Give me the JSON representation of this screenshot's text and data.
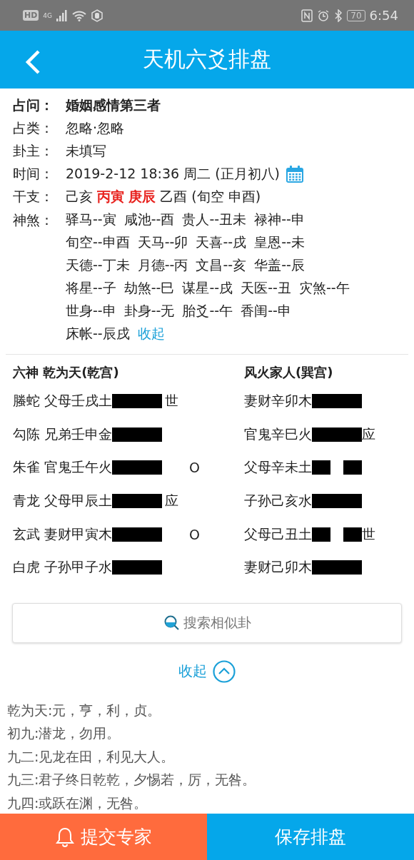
{
  "status_bar": {
    "hd": "HD",
    "network": "4G",
    "battery": "70",
    "time": "6:54"
  },
  "header": {
    "title": "天机六爻排盘"
  },
  "info": {
    "question": {
      "label": "占问：",
      "value": "婚姻感情第三者"
    },
    "rows": [
      {
        "label": "占类：",
        "value": "忽略·忽略"
      },
      {
        "label": "卦主：",
        "value": "未填写"
      },
      {
        "label": "时间：",
        "value": "2019-2-12 18:36 周二 (正月初八)",
        "calendar": true
      }
    ],
    "ganzhi": {
      "label": "干支：",
      "parts": [
        {
          "text": "己亥",
          "highlight": false
        },
        {
          "text": "丙寅",
          "highlight": true
        },
        {
          "text": "庚辰",
          "highlight": true
        },
        {
          "text": "乙酉 (旬空 申酉)",
          "highlight": false
        }
      ]
    },
    "shensha": {
      "label": "神煞：",
      "lines": [
        [
          "驿马--寅",
          "咸池--酉",
          "贵人--丑未",
          "禄神--申"
        ],
        [
          "旬空--申酉",
          "天马--卯",
          "天喜--戌",
          "皇恩--未"
        ],
        [
          "天德--丁未",
          "月德--丙",
          "文昌--亥",
          "华盖--辰"
        ],
        [
          "将星--子",
          "劫煞--巳",
          "谋星--戌",
          "天医--丑",
          "灾煞--午"
        ],
        [
          "世身--申",
          "卦身--无",
          "胎爻--午",
          "香闺--申"
        ],
        [
          "床帐--辰戌"
        ]
      ],
      "collapse": "收起"
    }
  },
  "hexagrams": {
    "main": {
      "title": "六神 乾为天(乾宫)",
      "lines": [
        {
          "spirit": "螣蛇",
          "text": "父母壬戌土",
          "kind": "yang",
          "mark": "世"
        },
        {
          "spirit": "勾陈",
          "text": "兄弟壬申金",
          "kind": "yang"
        },
        {
          "spirit": "朱雀",
          "text": "官鬼壬午火",
          "kind": "yang",
          "moving": "O"
        },
        {
          "spirit": "青龙",
          "text": "父母甲辰土",
          "kind": "yang",
          "mark": "应"
        },
        {
          "spirit": "玄武",
          "text": "妻财甲寅木",
          "kind": "yang",
          "moving": "O"
        },
        {
          "spirit": "白虎",
          "text": "子孙甲子水",
          "kind": "yang"
        }
      ]
    },
    "changed": {
      "title": "风火家人(巽宫)",
      "lines": [
        {
          "text": "妻财辛卯木",
          "kind": "yang"
        },
        {
          "text": "官鬼辛巳火",
          "kind": "yang",
          "mark": "应"
        },
        {
          "text": "父母辛未土",
          "kind": "yin"
        },
        {
          "text": "子孙己亥水",
          "kind": "yang"
        },
        {
          "text": "父母己丑土",
          "kind": "yin",
          "mark": "世"
        },
        {
          "text": "妻财己卯木",
          "kind": "yang"
        }
      ]
    }
  },
  "search_button": "搜索相似卦",
  "collapse_toggle": {
    "label": "收起",
    "expanded": true
  },
  "text_lines": [
    "乾为天:元，亨，利，贞。",
    "初九:潜龙，勿用。",
    "九二:见龙在田，利见大人。",
    "九三:君子终日乾乾，夕惕若，厉，无咎。",
    "九四:或跃在渊，无咎。"
  ],
  "footer": {
    "submit": "提交专家",
    "save": "保存排盘"
  }
}
